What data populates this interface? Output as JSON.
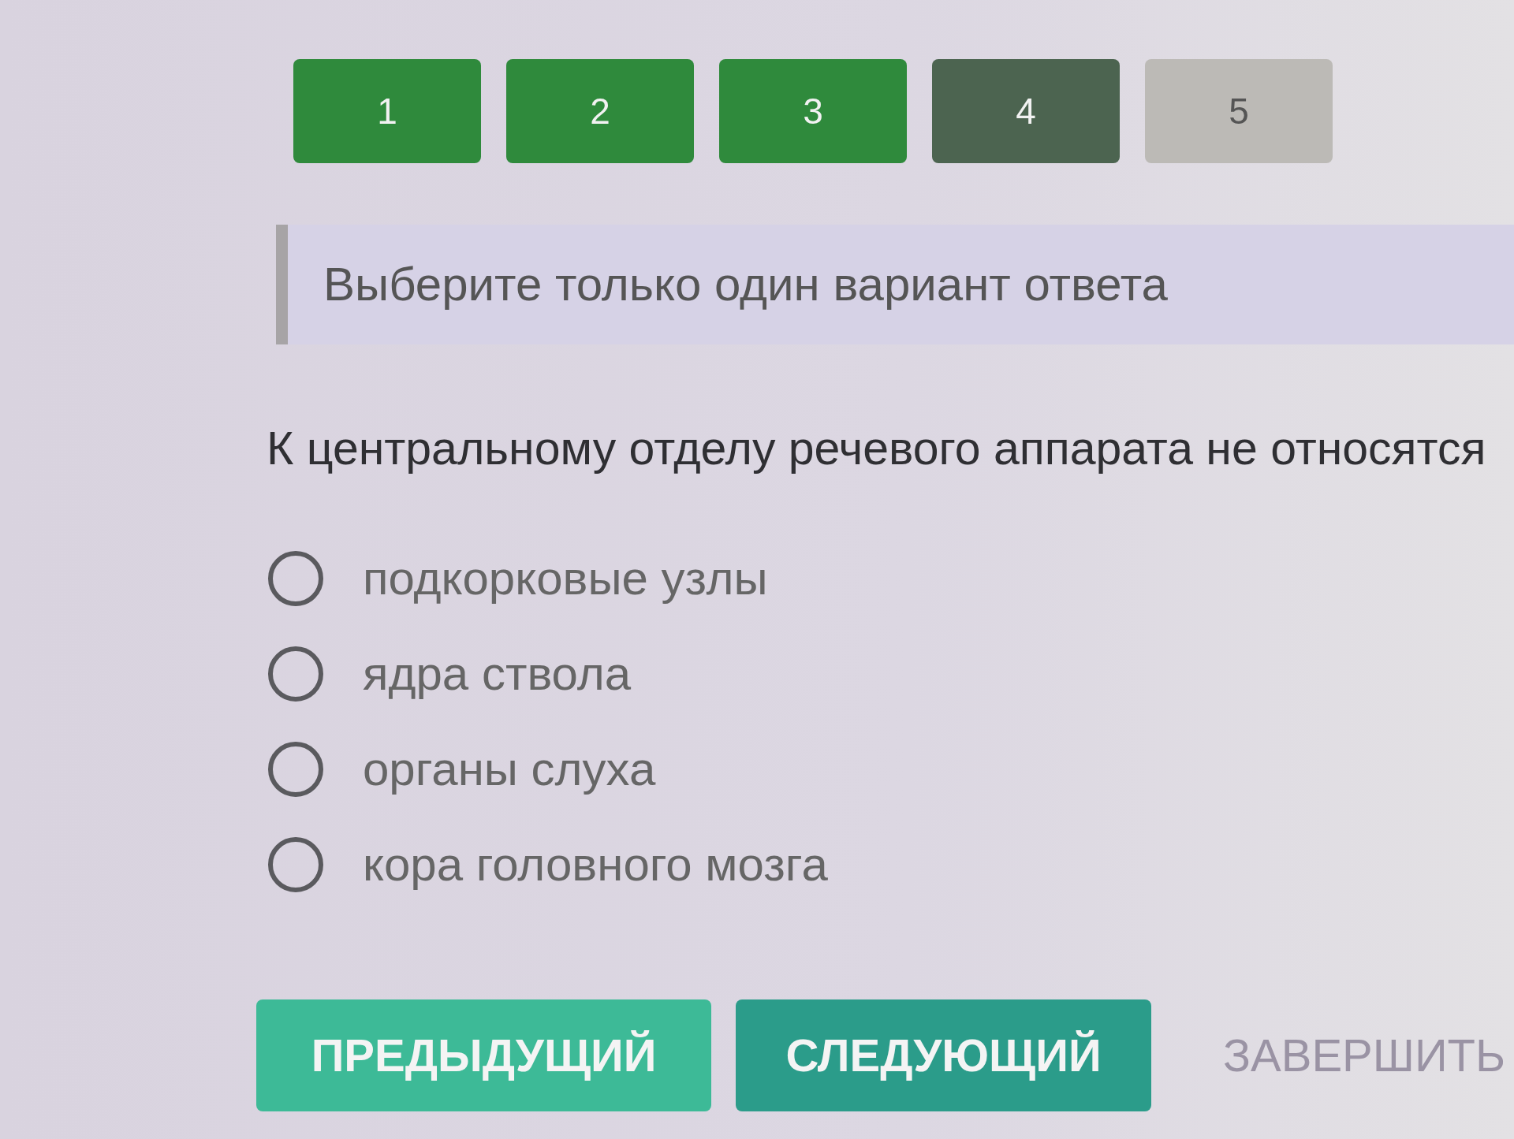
{
  "tabs": [
    {
      "label": "1",
      "answered": true,
      "selected": false
    },
    {
      "label": "2",
      "answered": true,
      "selected": false
    },
    {
      "label": "3",
      "answered": true,
      "selected": false
    },
    {
      "label": "4",
      "answered": false,
      "selected": true
    },
    {
      "label": "5",
      "answered": false,
      "selected": false
    }
  ],
  "instruction": "Выберите только один вариант ответа",
  "question": "К центральному отделу речевого аппарата не относятся",
  "options": [
    {
      "label": "подкорковые узлы",
      "selected": false
    },
    {
      "label": "ядра ствола",
      "selected": false
    },
    {
      "label": "органы слуха",
      "selected": false
    },
    {
      "label": "кора головного мозга",
      "selected": false
    }
  ],
  "buttons": [
    {
      "label": "ПРЕДЫДУЩИЙ",
      "kind": "previous",
      "disabled": false
    },
    {
      "label": "СЛЕДУЮЩИЙ",
      "kind": "next",
      "disabled": false
    },
    {
      "label": "ЗАВЕРШИТЬ",
      "kind": "finish",
      "disabled": true
    }
  ]
}
